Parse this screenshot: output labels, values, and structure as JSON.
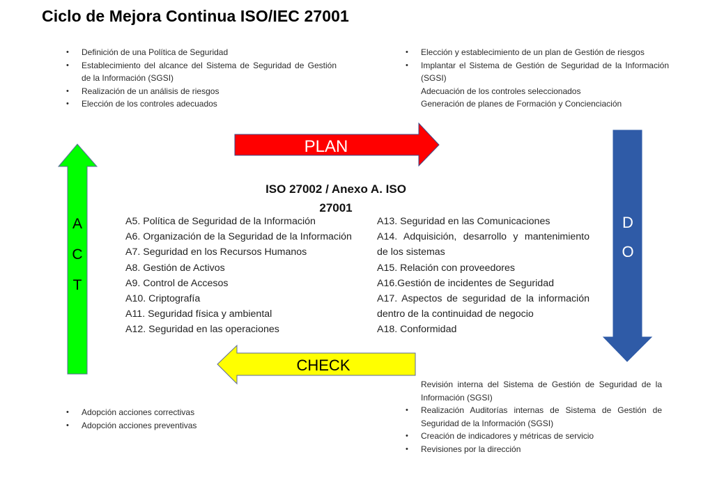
{
  "title": "Ciclo de Mejora Continua ISO/IEC 27001",
  "arrows": {
    "plan": {
      "label": "PLAN",
      "color": "#ff0000",
      "text_color": "#ffffff",
      "direction": "right"
    },
    "do": {
      "label_letters": [
        "D",
        "O"
      ],
      "color": "#2f5ba7",
      "text_color": "#ffffff",
      "direction": "down"
    },
    "check": {
      "label": "CHECK",
      "color": "#ffff00",
      "text_color": "#000000",
      "direction": "left"
    },
    "act": {
      "label_letters": [
        "A",
        "C",
        "T"
      ],
      "color": "#00ff00",
      "text_color": "#000000",
      "direction": "up"
    }
  },
  "plan_items": [
    {
      "text": "Definición de una Política de Seguridad",
      "bullet": true
    },
    {
      "text": "Establecimiento del alcance del Sistema de Seguridad de Gestión de la Información (SGSI)",
      "bullet": true
    },
    {
      "text": "Realización de un análisis de riesgos",
      "bullet": true
    },
    {
      "text": "Elección de los controles adecuados",
      "bullet": true
    }
  ],
  "do_items": [
    {
      "text": "Elección y establecimiento de un plan de Gestión de riesgos",
      "bullet": true
    },
    {
      "text": "Implantar el Sistema de Gestión de Seguridad de la Información (SGSI)",
      "bullet": true
    },
    {
      "text": "Adecuación de los controles seleccionados",
      "bullet": false
    },
    {
      "text": "Generación de planes de Formación y Concienciación",
      "bullet": false
    }
  ],
  "check_items": [
    {
      "text": "Revisión interna del Sistema de Gestión de Seguridad de la Información (SGSI)",
      "bullet": false
    },
    {
      "text": "Realización Auditorías internas de Sistema de Gestión de Seguridad de la Información (SGSI)",
      "bullet": true
    },
    {
      "text": "Creación de indicadores y métricas de servicio",
      "bullet": true
    },
    {
      "text": "Revisiones por la dirección",
      "bullet": true
    }
  ],
  "act_items": [
    {
      "text": "Adopción acciones correctivas",
      "bullet": true
    },
    {
      "text": "Adopción acciones preventivas",
      "bullet": true
    }
  ],
  "center": {
    "title_line1": "ISO 27002 / Anexo A. ISO",
    "title_line2": "27001",
    "controls_left": [
      "A5. Política de Seguridad de la Información",
      "A6. Organización de la Seguridad de la Información",
      "A7. Seguridad en los Recursos Humanos",
      "A8. Gestión de Activos",
      "A9. Control de Accesos",
      "A10. Criptografía",
      "A11. Seguridad física y ambiental",
      "A12. Seguridad en las operaciones"
    ],
    "controls_right": [
      "A13. Seguridad en las Comunicaciones",
      "A14. Adquisición, desarrollo y mantenimiento",
      "de los sistemas",
      "A15. Relación con proveedores",
      "A16.Gestión de incidentes de Seguridad",
      "A17. Aspectos de seguridad de la información",
      "dentro de la continuidad de negocio",
      "A18. Conformidad"
    ]
  }
}
